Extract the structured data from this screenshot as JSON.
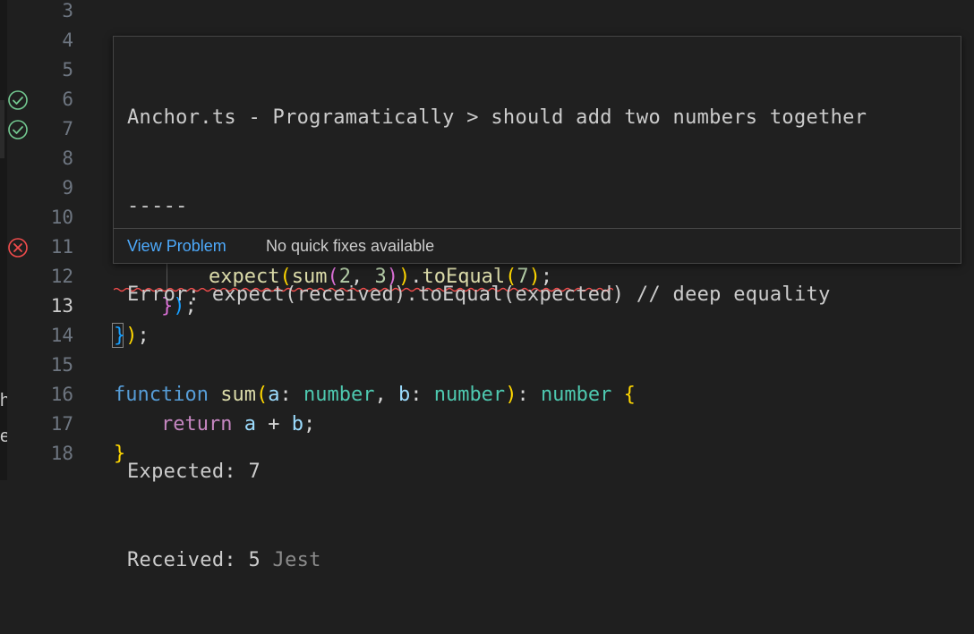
{
  "colors": {
    "editor_background": "#1f1f1f",
    "line_number": "#6e7681",
    "line_number_active": "#cccccc",
    "pass_icon": "#73c991",
    "fail_icon": "#f14c4c",
    "error_squiggle": "#f14c4c",
    "link": "#4daafc"
  },
  "left_edge": {
    "glyphs": [
      "h",
      "e"
    ]
  },
  "editor": {
    "lines": [
      {
        "number": "3"
      },
      {
        "number": "4"
      },
      {
        "number": "5"
      },
      {
        "number": "6",
        "status_icon": "test-passed-icon"
      },
      {
        "number": "7",
        "status_icon": "test-passed-icon"
      },
      {
        "number": "8"
      },
      {
        "number": "9"
      },
      {
        "number": "10"
      },
      {
        "number": "11",
        "status_icon": "test-failed-icon"
      },
      {
        "number": "12",
        "tokens": [
          "expect",
          "(",
          "sum",
          "(",
          "2",
          ", ",
          "3",
          ")",
          ")",
          ".",
          "toEqual",
          "(",
          "7",
          ")",
          ";"
        ],
        "has_error": true
      },
      {
        "number": "13",
        "active": true,
        "tokens": [
          "}",
          ")",
          ";"
        ]
      },
      {
        "number": "14",
        "tokens": [
          "}",
          ")",
          ";"
        ]
      },
      {
        "number": "15"
      },
      {
        "number": "16",
        "tokens": [
          "function",
          " ",
          "sum",
          "(",
          "a",
          ": ",
          "number",
          ", ",
          "b",
          ": ",
          "number",
          ")",
          ": ",
          "number",
          " ",
          "{"
        ]
      },
      {
        "number": "17",
        "tokens": [
          "return",
          " ",
          "a",
          " + ",
          "b",
          ";"
        ]
      },
      {
        "number": "18",
        "tokens": [
          "}"
        ]
      }
    ]
  },
  "hover": {
    "title": "Anchor.ts - Programatically > should add two numbers together",
    "separator": "-----",
    "error": "Error: expect(received).toEqual(expected) // deep equality",
    "expected": "Expected: 7",
    "received": "Received: 5",
    "source": "Jest",
    "actions": {
      "view_problem": "View Problem",
      "no_quick_fixes": "No quick fixes available"
    }
  }
}
